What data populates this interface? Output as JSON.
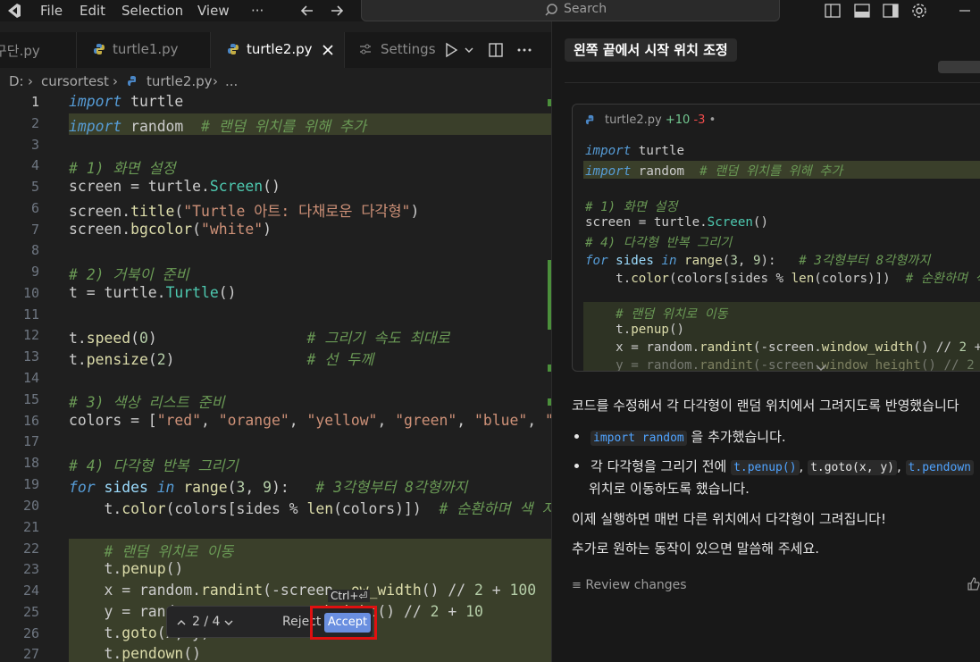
{
  "menu": [
    "File",
    "Edit",
    "Selection",
    "View",
    "···"
  ],
  "search": {
    "label": "Search"
  },
  "tabs": [
    {
      "label": "구단.py"
    },
    {
      "label": "turtle1.py"
    },
    {
      "label": "turtle2.py"
    },
    {
      "label": "Settings"
    }
  ],
  "breadcrumb": {
    "drive": "D:",
    "folder": "cursortest",
    "file": "turtle2.py",
    "more": "..."
  },
  "code": {
    "lines": [
      {
        "n": "1"
      },
      {
        "n": "2"
      },
      {
        "n": "3"
      },
      {
        "n": "4"
      },
      {
        "n": "5"
      },
      {
        "n": "6"
      },
      {
        "n": "7"
      },
      {
        "n": "8"
      },
      {
        "n": "9"
      },
      {
        "n": "10"
      },
      {
        "n": "11"
      },
      {
        "n": "12"
      },
      {
        "n": "13"
      },
      {
        "n": "14"
      },
      {
        "n": "15"
      },
      {
        "n": "16"
      },
      {
        "n": "17"
      },
      {
        "n": "18"
      },
      {
        "n": "19"
      },
      {
        "n": "20"
      },
      {
        "n": "21"
      },
      {
        "n": "22"
      },
      {
        "n": "23"
      },
      {
        "n": "24"
      },
      {
        "n": "25"
      },
      {
        "n": "26"
      },
      {
        "n": "27"
      }
    ],
    "t_import": "import",
    "t_turtle": " turtle",
    "t_random": " random",
    "c_random": "  # 랜덤 위치를 위해 추가",
    "c_1": "# 1) 화면 설정",
    "l5a": "screen = turtle.",
    "l5b": "Screen",
    "l5c": "()",
    "l6a": "screen.",
    "l6b": "title",
    "l6c": "(",
    "l6d": "\"Turtle 아트: 다채로운 다각형\"",
    "l6e": ")",
    "l7a": "screen.",
    "l7b": "bgcolor",
    "l7c": "(",
    "l7d": "\"white\"",
    "l7e": ")",
    "c_2": "# 2) 거북이 준비",
    "l10a": "t = turtle.",
    "l10b": "Turtle",
    "l10c": "()",
    "l12a": "t.",
    "l12b": "speed",
    "l12c": "(",
    "l12d": "0",
    "l12e": ")",
    "l12f": "                 # 그리기 속도 최대로",
    "l13a": "t.",
    "l13b": "pensize",
    "l13c": "(",
    "l13d": "2",
    "l13e": ")",
    "l13f": "               # 선 두께",
    "c_3": "# 3) 색상 리스트 준비",
    "l16a": "colors = [",
    "l16b": "\"red\"",
    "l16c": ", ",
    "l16d": "\"orange\"",
    "l16f": "\"yellow\"",
    "l16h": "\"green\"",
    "l16j": "\"blue\"",
    "l16l": "\"p",
    "c_4": "# 4) 다각형 반복 그리기",
    "l19a": "for",
    "l19b": " sides ",
    "l19c": "in",
    "l19d": " ",
    "l19e": "range",
    "l19f": "(",
    "l19g": "3",
    "l19h": ", ",
    "l19i": "9",
    "l19j": "):",
    "l19k": "   # 3각형부터 8각형까지",
    "l20a": "    t.",
    "l20b": "color",
    "l20c": "(colors[sides % ",
    "l20d": "len",
    "l20e": "(colors)])",
    "l20f": "  # 순환하며 색 지",
    "l22": "    # 랜덤 위치로 이동",
    "l23a": "    t.",
    "l23b": "penup",
    "l23c": "()",
    "l24a": "    x = random.",
    "l24b": "randint",
    "l24c": "(-screen",
    "l24d": "ow_width",
    "l24e": "() // ",
    "l24f": "2",
    "l24g": " + ",
    "l24h": "100",
    "l25a": "    y = rand",
    "l25b": "w_height",
    "l25c": "() // ",
    "l25d": "2",
    "l25e": " + ",
    "l25f": "10",
    "l26a": "    t.",
    "l26b": "goto",
    "l26c": "(x, y)",
    "l27a": "    t.",
    "l27b": "pendown",
    "l27c": "()"
  },
  "diffnav": {
    "count": "2 / 4",
    "reject": "Reject",
    "accept": "Accept",
    "shortcut": "Ctrl+⏎"
  },
  "chat": {
    "title": "왼쪽 끝에서 시작 위치 조정",
    "card": {
      "file": "turtle2.py",
      "added": "+10",
      "removed": "-3",
      "dot": "•"
    },
    "card_code": {
      "l1a": "import",
      "l1b": " turtle",
      "l2a": "import",
      "l2b": " random",
      "l2c": "  # 랜덤 위치를 위해 추가",
      "l4": "# 1) 화면 설정",
      "l5a": "screen = turtle.",
      "l5b": "Screen",
      "l5c": "()",
      "l6": "# 4) 다각형 반복 그리기",
      "l7a": "for",
      "l7b": " sides ",
      "l7c": "in",
      "l7d": " range",
      "l7e": "(",
      "l7f": "3",
      "l7g": ", ",
      "l7h": "9",
      "l7i": "):",
      "l7j": "   # 3각형부터 8각형까지",
      "l8a": "    t.",
      "l8b": "color",
      "l8c": "(colors[sides % ",
      "l8d": "len",
      "l8e": "(colors)])",
      "l8f": "  # 순환하며 색",
      "l10": "    # 랜덤 위치로 이동",
      "l11a": "    t.",
      "l11b": "penup",
      "l11c": "()",
      "l12a": "    x = random.",
      "l12b": "randint",
      "l12c": "(-screen.",
      "l12d": "window_width",
      "l12e": "() // ",
      "l12f": "2",
      "l12g": " + 1",
      "l13a": "    y = random.",
      "l13b": "randint",
      "l13c": "(-screen.",
      "l13d": "window_height",
      "l13e": "() // ",
      "l13f": "2",
      "l13g": " + "
    },
    "p1": "코드를 수정해서 각 다각형이 랜덤 위치에서 그려지도록 반영했습니다",
    "b1_code": "import random",
    "b1_text": " 을 추가했습니다.",
    "b2_a": "각 다각형을 그리기 전에 ",
    "b2_code1": "t.penup()",
    "b2_sep1": ", ",
    "b2_code2": "t.goto(x, y)",
    "b2_sep2": ", ",
    "b2_code3": "t.pendown",
    "b2_b": "위치로 이동하도록 했습니다.",
    "p2": "이제 실행하면 매번 다른 위치에서 다각형이 그려집니다!",
    "p3": "추가로 원하는 동작이 있으면 말씀해 주세요.",
    "review": "Review changes"
  },
  "colors": {
    "accent": "#6a8fe0",
    "highlight": "#e01010",
    "added_bg": "#3a3f2a"
  }
}
